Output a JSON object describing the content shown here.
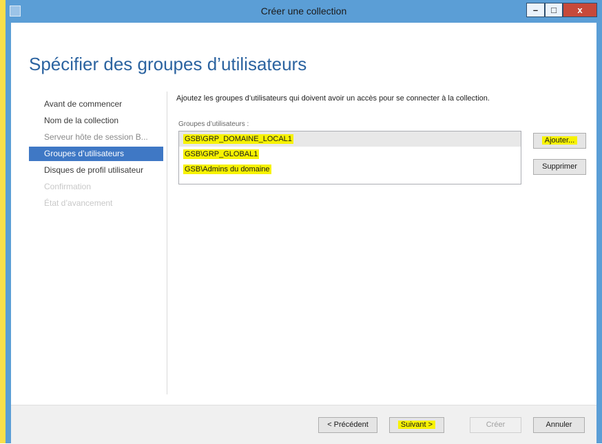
{
  "window": {
    "title": "Créer une collection",
    "controls": {
      "minimize": "–",
      "maximize": "□",
      "close": "x"
    }
  },
  "page": {
    "heading": "Spécifier des groupes d’utilisateurs",
    "description": "Ajoutez les groupes d’utilisateurs qui doivent avoir un accès pour se connecter à la collection."
  },
  "nav": {
    "items": [
      {
        "label": "Avant de commencer",
        "state": "normal"
      },
      {
        "label": "Nom de la collection",
        "state": "normal"
      },
      {
        "label": "Serveur hôte de session B...",
        "state": "dim"
      },
      {
        "label": "Groupes d’utilisateurs",
        "state": "selected"
      },
      {
        "label": "Disques de profil utilisateur",
        "state": "normal"
      },
      {
        "label": "Confirmation",
        "state": "disabled"
      },
      {
        "label": "État d’avancement",
        "state": "disabled"
      }
    ]
  },
  "groups": {
    "label": "Groupes d’utilisateurs :",
    "items": [
      "GSB\\GRP_DOMAINE_LOCAL1",
      "GSB\\GRP_GLOBAL1",
      "GSB\\Admins du domaine"
    ],
    "add_label": "Ajouter...",
    "remove_label": "Supprimer"
  },
  "footer": {
    "previous_label": "< Précédent",
    "next_label": "Suivant >",
    "create_label": "Créer",
    "cancel_label": "Annuler"
  },
  "colors": {
    "accent": "#3f78c5",
    "title_bar": "#5b9ed6",
    "highlight": "#f7f200",
    "heading": "#2b63a0"
  }
}
